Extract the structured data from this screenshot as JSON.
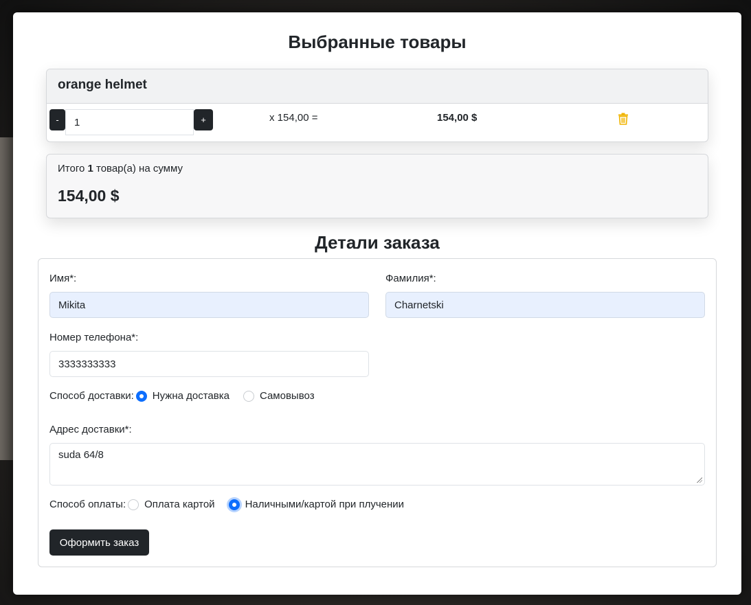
{
  "cart": {
    "title": "Выбранные товары",
    "items": [
      {
        "name": "orange helmet",
        "minus_label": "-",
        "plus_label": "+",
        "quantity": "1",
        "unit_price": "x 154,00 =",
        "line_total": "154,00 $"
      }
    ],
    "summary": {
      "prefix": "Итого",
      "count": "1",
      "suffix": "товар(а) на сумму",
      "total": "154,00 $"
    }
  },
  "order": {
    "title": "Детали заказа",
    "first_name": {
      "label": "Имя*:",
      "value": "Mikita"
    },
    "last_name": {
      "label": "Фамилия*:",
      "value": "Charnetski"
    },
    "phone": {
      "label": "Номер телефона*:",
      "value": "3333333333"
    },
    "delivery": {
      "label": "Способ доставки:",
      "options": [
        {
          "label": "Нужна доставка",
          "checked": true
        },
        {
          "label": "Самовывоз",
          "checked": false
        }
      ]
    },
    "address": {
      "label": "Адрес доставки*:",
      "value": "suda 64/8"
    },
    "payment": {
      "label": "Способ оплаты:",
      "options": [
        {
          "label": "Оплата картой",
          "checked": false
        },
        {
          "label": "Наличными/картой при плучении",
          "checked": true
        }
      ]
    },
    "submit_label": "Оформить заказ"
  },
  "colors": {
    "primary": "#0d6efd",
    "dark_button": "#212529",
    "trash_icon": "#f0b400",
    "autofill": "#e8f0fe"
  }
}
